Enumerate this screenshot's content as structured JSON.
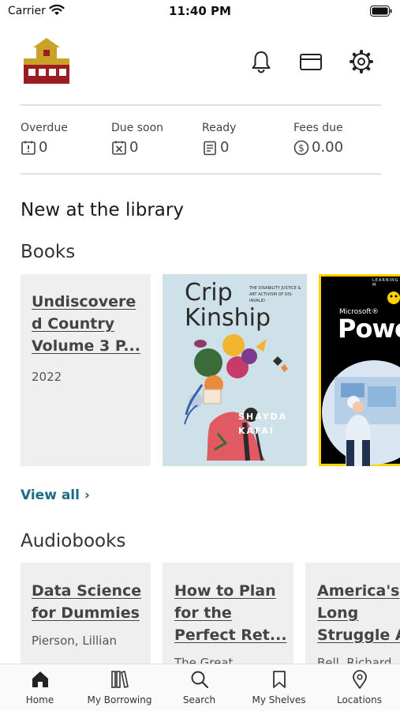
{
  "status_bar": {
    "carrier": "Carrier",
    "time": "11:40 PM"
  },
  "stats": [
    {
      "label": "Overdue",
      "value": "0"
    },
    {
      "label": "Due soon",
      "value": "0"
    },
    {
      "label": "Ready",
      "value": "0"
    },
    {
      "label": "Fees due",
      "value": "0.00"
    }
  ],
  "new_section": {
    "title": "New at the library"
  },
  "books": {
    "title": "Books",
    "items": [
      {
        "title": "Undiscovere d Country Volume 3 P...",
        "subtitle": "2022"
      },
      {
        "cover_title": "Crip Kinship",
        "cover_subtitle": "THE DISABILITY JUSTICE & ART ACTIVISM OF DIS-INVALID",
        "cover_author": "SHAYDA KAFAI"
      },
      {
        "cover_brand": "Microsoft®",
        "cover_title": "Powe",
        "cover_badge": "LEARNING M"
      }
    ],
    "view_all": "View all ›"
  },
  "audiobooks": {
    "title": "Audiobooks",
    "items": [
      {
        "title": "Data Science for Dummies",
        "subtitle": "Pierson, Lillian"
      },
      {
        "title": "How to Plan for the Perfect Ret...",
        "subtitle": "The Great"
      },
      {
        "title": "America's Long Struggle A",
        "subtitle": "Bell, Richard"
      }
    ]
  },
  "tabs": [
    {
      "label": "Home",
      "icon": "home-icon"
    },
    {
      "label": "My Borrowing",
      "icon": "books-icon"
    },
    {
      "label": "Search",
      "icon": "search-icon"
    },
    {
      "label": "My Shelves",
      "icon": "bookmark-icon"
    },
    {
      "label": "Locations",
      "icon": "location-icon"
    }
  ],
  "colors": {
    "link": "#1c6b85",
    "logo_red": "#9b1c23",
    "logo_gold": "#c9a227"
  }
}
